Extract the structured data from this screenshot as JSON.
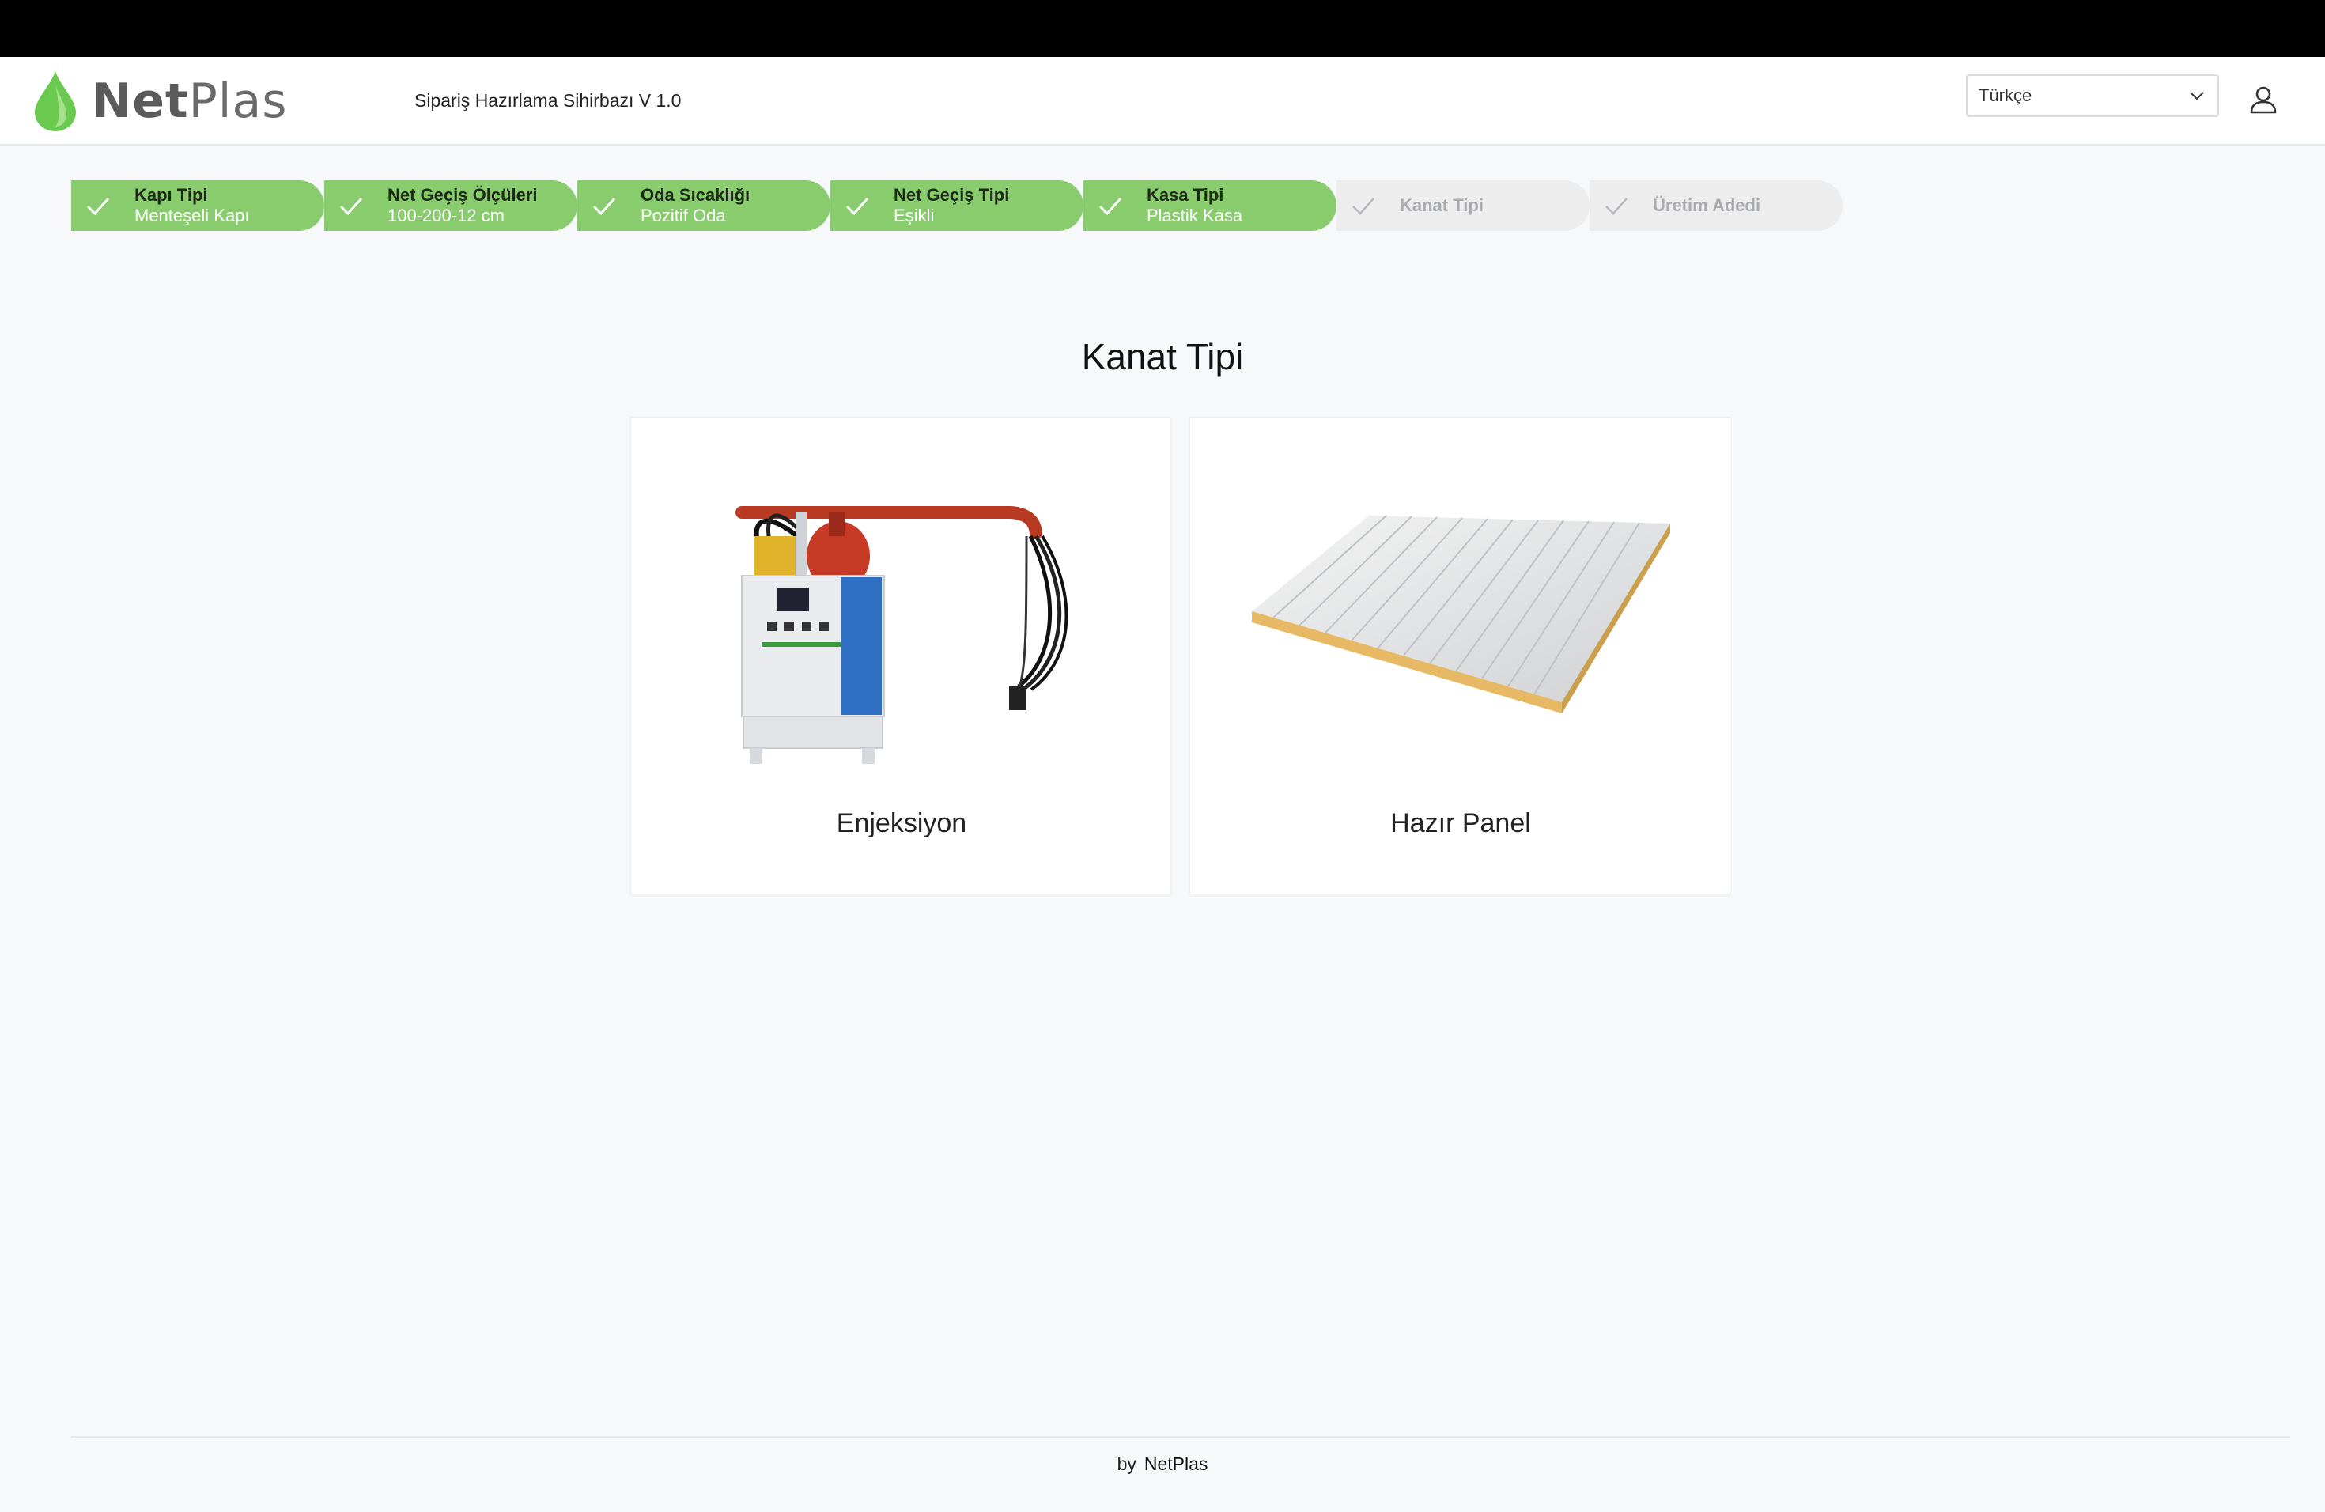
{
  "header": {
    "logo_text_bold": "Net",
    "logo_text_light": "Plas",
    "app_title": "Sipariş Hazırlama Sihirbazı V 1.0",
    "language": "Türkçe"
  },
  "colors": {
    "step_done": "#88cc6e",
    "step_pending": "#ededee",
    "logo_green": "#6ac94f"
  },
  "steps": [
    {
      "label": "Kapı Tipi",
      "value": "Menteşeli Kapı",
      "status": "done"
    },
    {
      "label": "Net Geçiş Ölçüleri",
      "value": "100-200-12 cm",
      "status": "done"
    },
    {
      "label": "Oda Sıcaklığı",
      "value": "Pozitif Oda",
      "status": "done"
    },
    {
      "label": "Net Geçiş Tipi",
      "value": "Eşikli",
      "status": "done"
    },
    {
      "label": "Kasa Tipi",
      "value": "Plastik Kasa",
      "status": "done"
    },
    {
      "label": "Kanat Tipi",
      "value": "",
      "status": "pending"
    },
    {
      "label": "Üretim Adedi",
      "value": "",
      "status": "pending"
    }
  ],
  "main": {
    "title": "Kanat Tipi",
    "options": [
      {
        "label": "Enjeksiyon",
        "icon": "injection-machine-image"
      },
      {
        "label": "Hazır Panel",
        "icon": "sandwich-panel-image"
      }
    ]
  },
  "footer": {
    "by": "by",
    "brand": "NetPlas"
  }
}
